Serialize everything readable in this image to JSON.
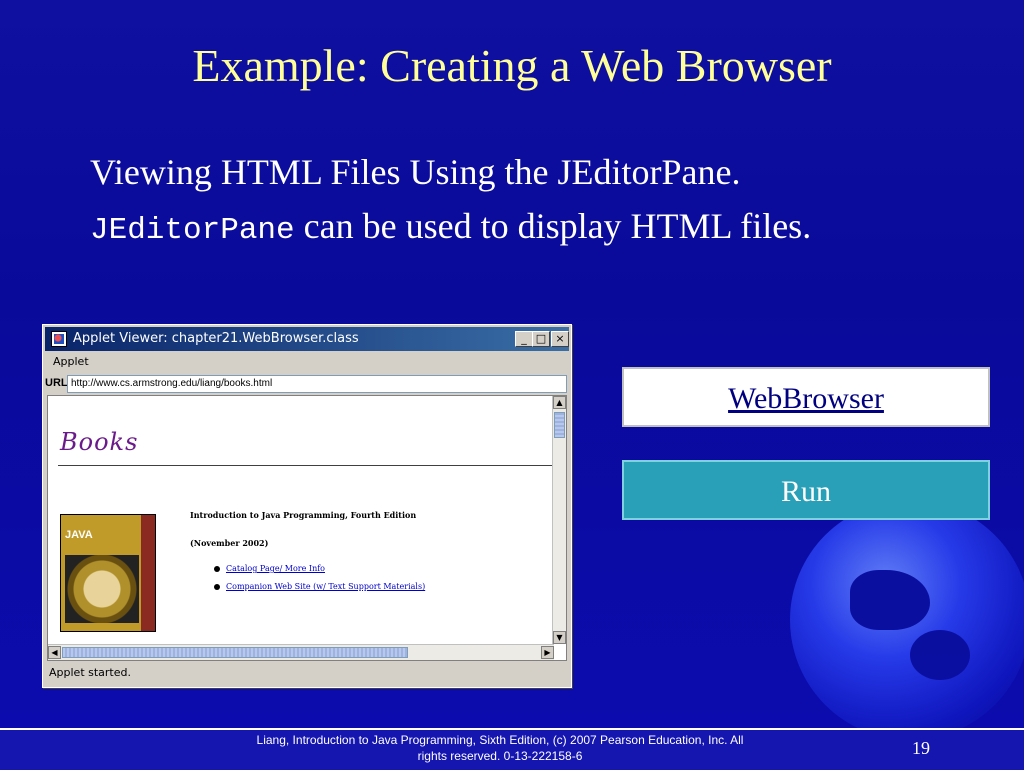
{
  "slide": {
    "title": "Example: Creating a Web Browser",
    "bullet_1": "Viewing HTML Files Using the JEditorPane.",
    "bullet_2_code": "JEditorPane",
    "bullet_2_rest": " can be used to display HTML files."
  },
  "applet": {
    "window_title": "Applet Viewer: chapter21.WebBrowser.class",
    "menu_applet": "Applet",
    "url_label": "URL",
    "url_value": "http://www.cs.armstrong.edu/liang/books.html",
    "books_heading": "Books",
    "book_title": "Introduction to Java Programming, Fourth Edition",
    "book_date": "(November 2002)",
    "links": [
      "Catalog Page/ More Info",
      "Companion Web Site (w/ Text Support Materials)"
    ],
    "cover_title": "JAVA",
    "status": "Applet started."
  },
  "buttons": {
    "webbrowser_label": "WebBrowser",
    "run_label": "Run"
  },
  "footer": {
    "line1": "Liang, Introduction to Java Programming, Sixth Edition, (c) 2007 Pearson Education, Inc. All",
    "line2": "rights reserved. 0-13-222158-6",
    "page_number": "19"
  },
  "colors": {
    "background": "#0a0a9a",
    "title": "#ffff99",
    "run_button": "#2aa0b8"
  }
}
